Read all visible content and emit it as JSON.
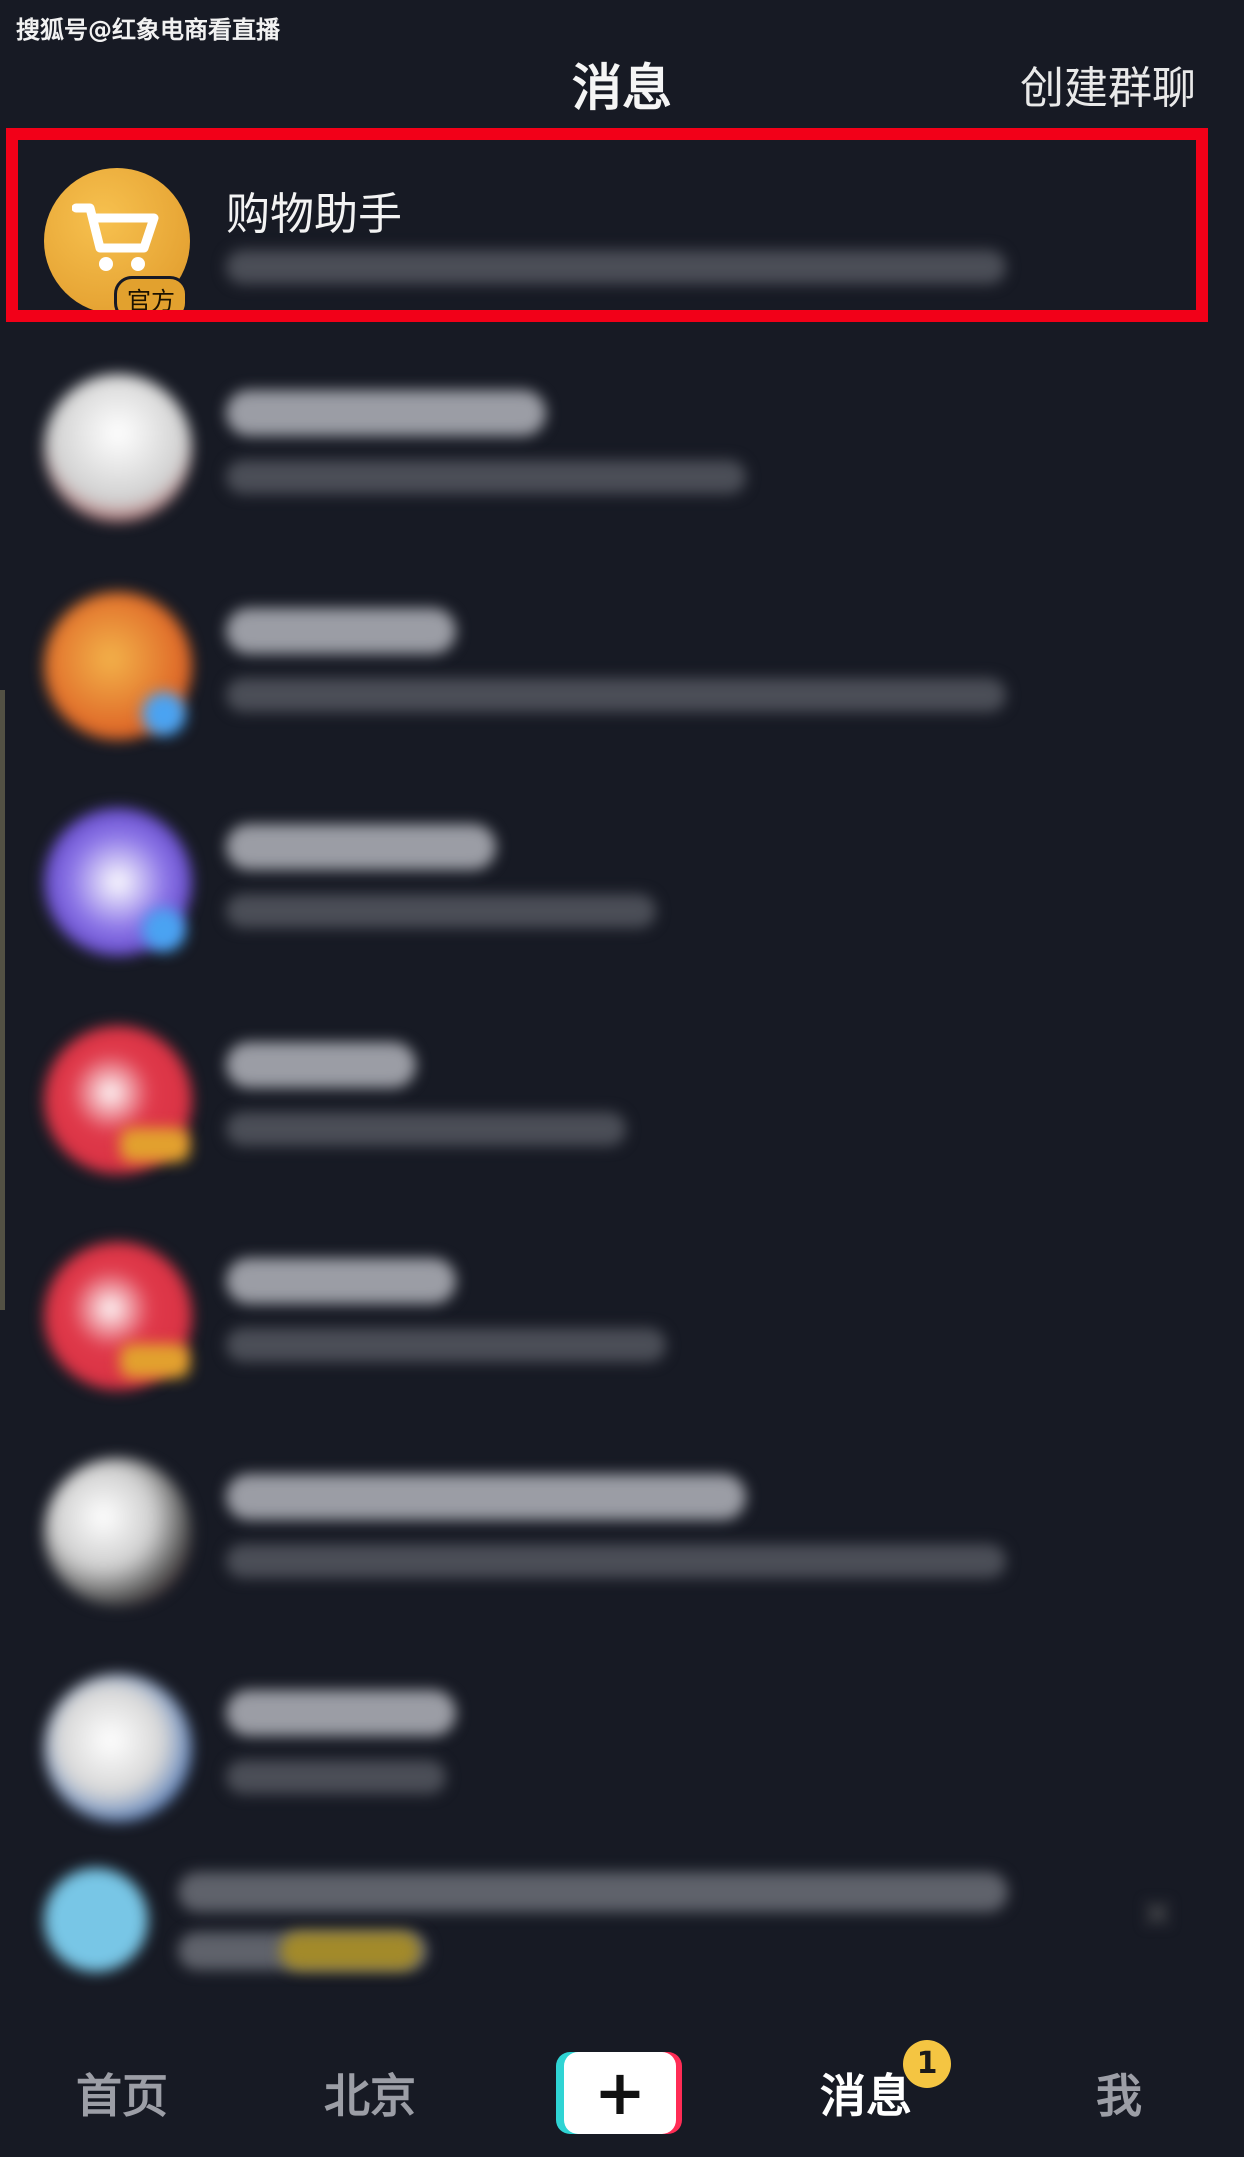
{
  "watermark": "搜狐号@红象电商看直播",
  "header": {
    "title": "消息",
    "action": "创建群聊"
  },
  "highlighted_row": {
    "name": "购物助手",
    "badge": "官方"
  },
  "tabs": [
    {
      "label": "首页",
      "active": false
    },
    {
      "label": "北京",
      "active": false
    },
    {
      "label": "+",
      "active": false
    },
    {
      "label": "消息",
      "active": true,
      "badge": "1"
    },
    {
      "label": "我",
      "active": false
    }
  ],
  "colors": {
    "highlight": "#f20018",
    "background": "#171a24",
    "official_badge": "#e2a12e",
    "message_badge": "#f4c542"
  }
}
